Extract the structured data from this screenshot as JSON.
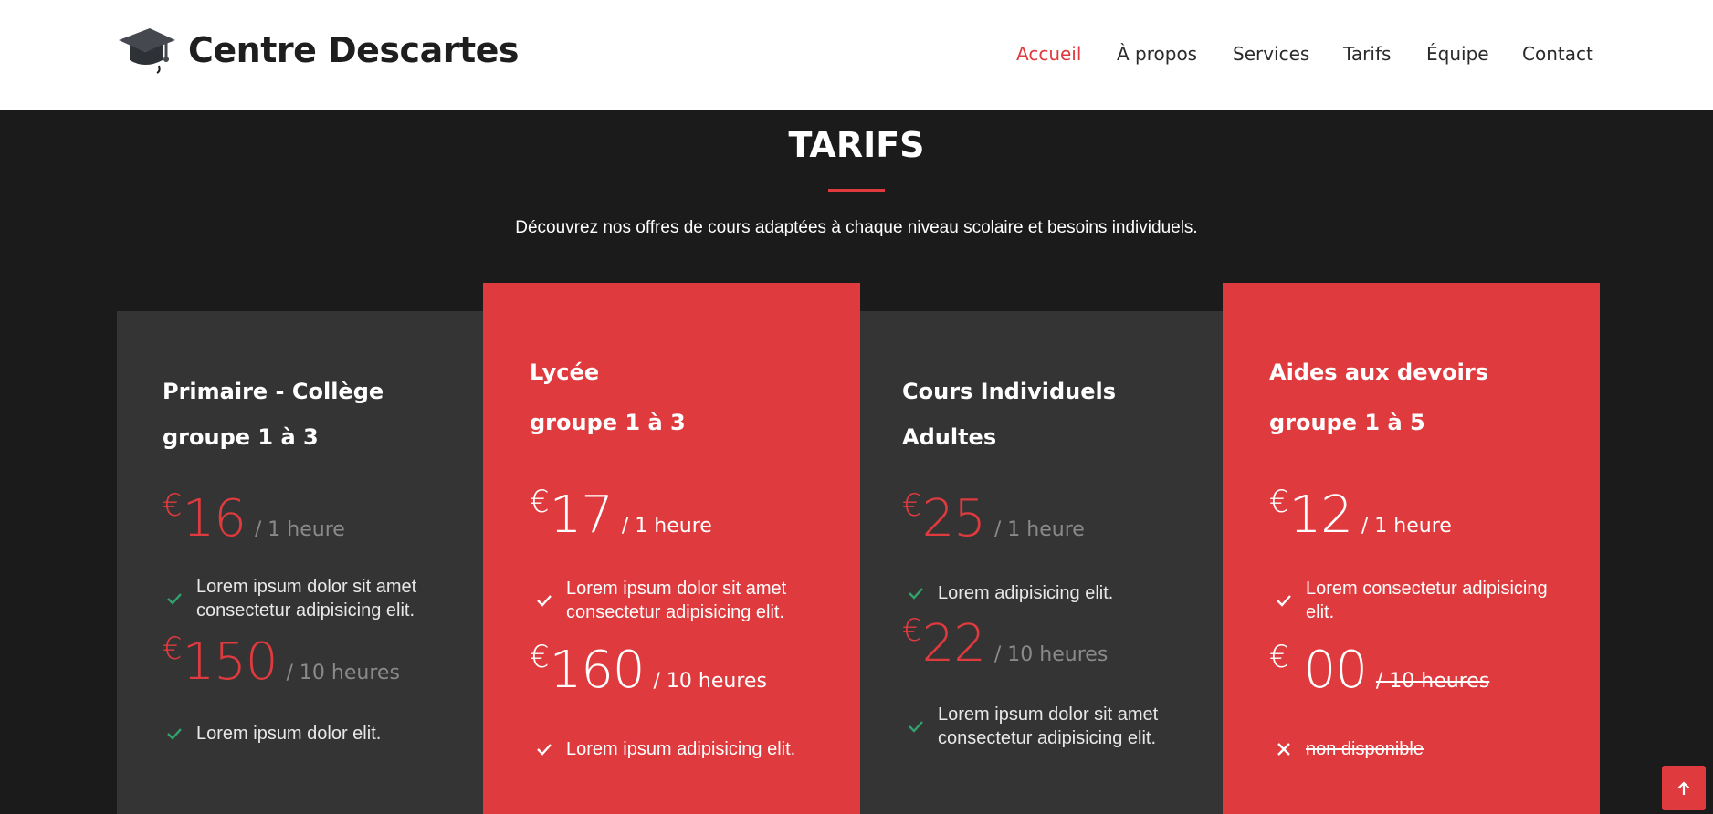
{
  "brand": {
    "name": "Centre Descartes"
  },
  "nav": {
    "items": [
      "Accueil",
      "À propos",
      "Services",
      "Tarifs",
      "Équipe",
      "Contact"
    ],
    "active": "Accueil"
  },
  "section": {
    "title": "TARIFS",
    "subtitle": "Découvrez nos offres de cours adaptées à chaque niveau scolaire et besoins individuels."
  },
  "plans": [
    {
      "title_line1": "Primaire - Collège",
      "title_line2": "groupe 1 à 3",
      "offers": [
        {
          "currency": "€",
          "amount": "16",
          "period": "/ 1 heure",
          "feature": "Lorem ipsum dolor sit amet consectetur adipisicing elit.",
          "feature_icon": "check-icon"
        },
        {
          "currency": "€",
          "amount": "150",
          "period": "/ 10 heures",
          "feature": "Lorem ipsum dolor elit.",
          "feature_icon": "check-icon"
        }
      ]
    },
    {
      "title_line1": "Lycée",
      "title_line2": "groupe 1 à 3",
      "offers": [
        {
          "currency": "€",
          "amount": "17",
          "period": "/ 1 heure",
          "feature": "Lorem ipsum dolor sit amet consectetur adipisicing elit.",
          "feature_icon": "check-icon"
        },
        {
          "currency": "€",
          "amount": "160",
          "period": "/ 10 heures",
          "feature": "Lorem ipsum adipisicing elit.",
          "feature_icon": "check-icon"
        }
      ]
    },
    {
      "title_line1": "Cours Individuels",
      "title_line2": "Adultes",
      "offers": [
        {
          "currency": "€",
          "amount": "25",
          "period": "/ 1 heure",
          "feature": "Lorem adipisicing elit.",
          "feature_icon": "check-icon"
        },
        {
          "currency": "€",
          "amount": "22",
          "period": "/ 10 heures",
          "feature": "Lorem ipsum dolor sit amet consectetur adipisicing elit.",
          "feature_icon": "check-icon"
        }
      ]
    },
    {
      "title_line1": "Aides aux devoirs",
      "title_line2": "groupe 1 à 5",
      "offers": [
        {
          "currency": "€",
          "amount": "12",
          "period": "/ 1 heure",
          "feature": "Lorem consectetur adipisicing elit.",
          "feature_icon": "check-icon"
        },
        {
          "currency": "€",
          "amount": "00",
          "period": "/ 10 heures",
          "feature": "non disponible",
          "feature_icon": "x-icon",
          "unavailable": true
        }
      ]
    }
  ],
  "colors": {
    "accent": "#df3a3e",
    "dark_card": "#343434",
    "background": "#1b1b1b",
    "check": "#2fa36b"
  },
  "back_to_top": {
    "icon": "arrow-up-icon"
  }
}
